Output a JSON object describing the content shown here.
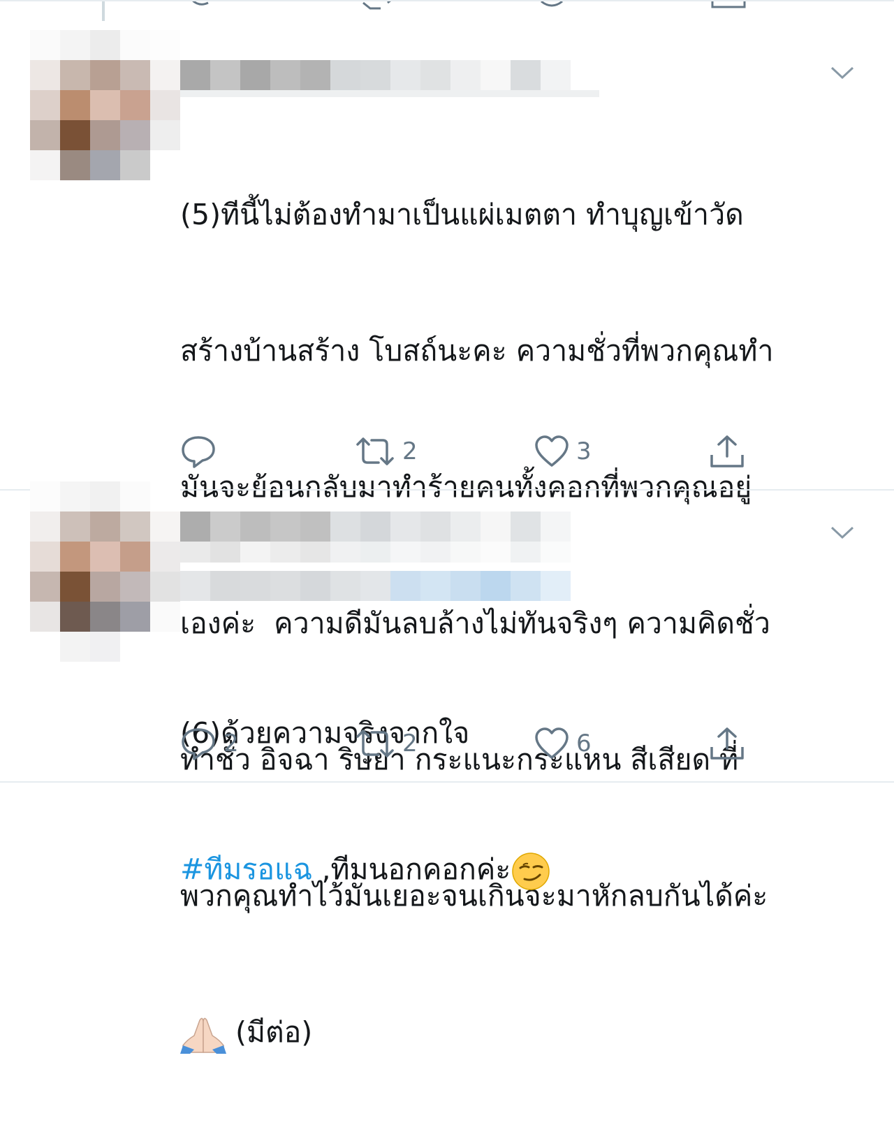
{
  "tweets": [
    {
      "text_lines": [
        "(5)ทีนี้ไม่ต้องทำมาเป็นแผ่เมตตา ทำบุญเข้าวัด",
        "สร้างบ้านสร้าง โบสถ์นะคะ ความชั่วที่พวกคุณทำ",
        "มันจะย้อนกลับมาทำร้ายคนทั้งคอกที่พวกคุณอยู่",
        "เองค่ะ  ความดีมันลบล้างไม่ทันจริงๆ ความคิดชั่ว",
        "ทำชั่ว อิจฉา ริษยา กระแนะกระแหน สีเสียด ที่",
        "พวกคุณทำไว้มันเยอะจนเกินจะมาหักลบกันได้ค่ะ"
      ],
      "last_line_suffix": " (มีต่อ)",
      "emoji": "folded-hands",
      "reply_count": "",
      "retweet_count": "2",
      "like_count": "3"
    },
    {
      "text_line1": "(6)ด้วยความจริงจากใจ",
      "hashtag": "#ทีมรอแฉ",
      "text_line2_rest": " ,ทีมนอกคอกค่ะ",
      "emoji": "smirking-face",
      "reply_count": "2",
      "retweet_count": "2",
      "like_count": "6"
    }
  ],
  "icons": {
    "reply": "reply-icon",
    "retweet": "retweet-icon",
    "like": "heart-icon",
    "share": "share-icon",
    "caret": "chevron-down-icon"
  },
  "colors": {
    "icon_gray": "#657786",
    "hashtag_blue": "#1b95e0",
    "divider": "#e6ecf0"
  }
}
